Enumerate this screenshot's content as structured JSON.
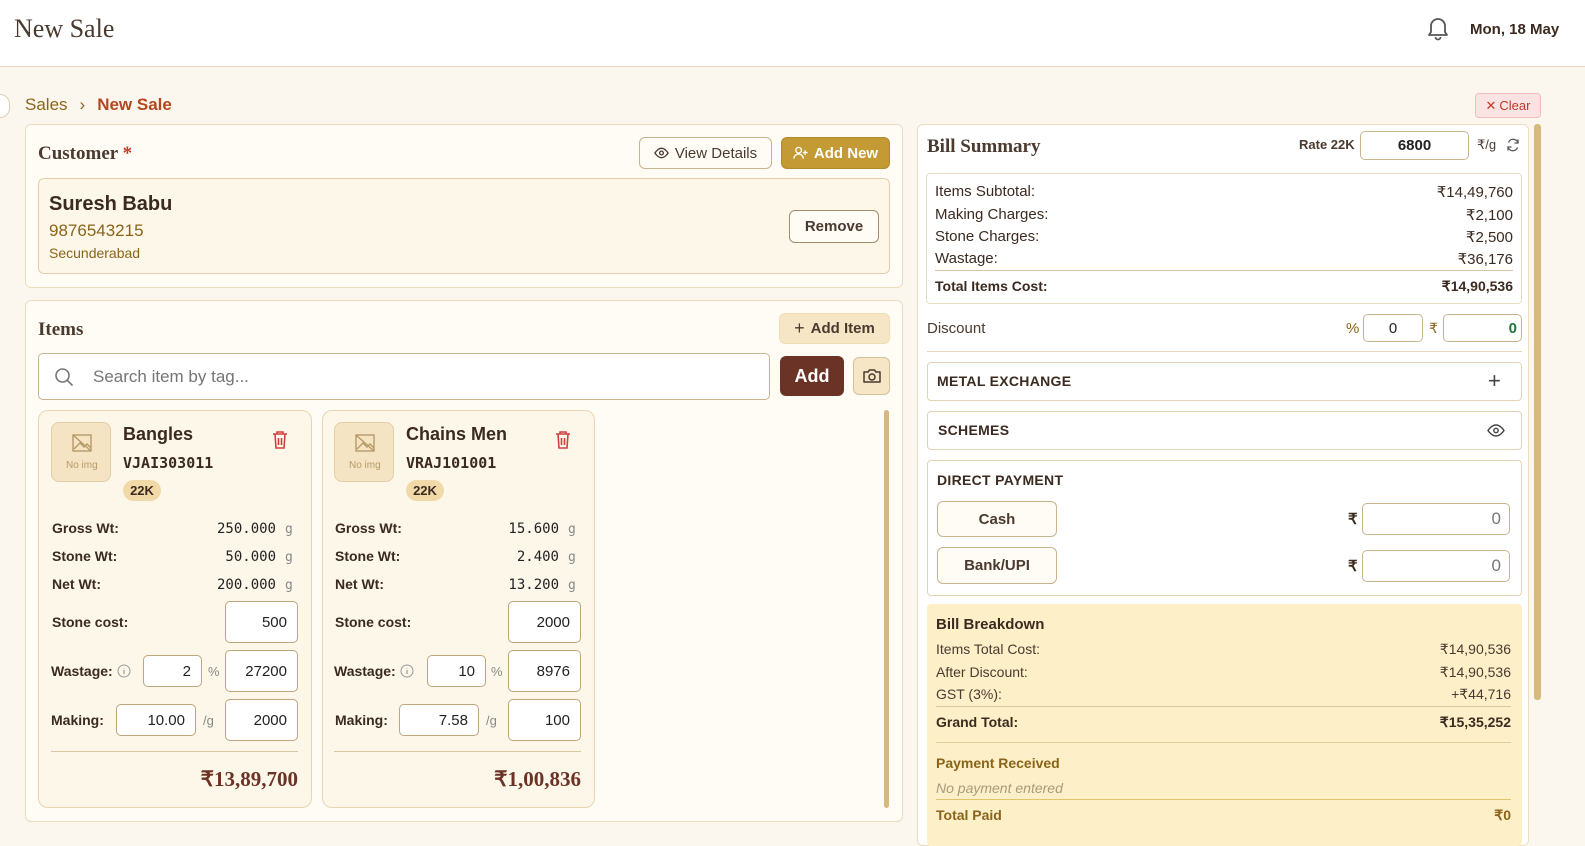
{
  "header": {
    "title": "New Sale",
    "date": "Mon, 18 May"
  },
  "breadcrumb": {
    "parent": "Sales",
    "current": "New Sale"
  },
  "clear_label": "Clear",
  "customer": {
    "heading": "Customer",
    "required_mark": "*",
    "view_details_label": "View Details",
    "add_new_label": "Add New",
    "name": "Suresh Babu",
    "phone": "9876543215",
    "city": "Secunderabad",
    "remove_label": "Remove"
  },
  "items": {
    "heading": "Items",
    "add_item_label": "Add Item",
    "search_placeholder": "Search item by tag...",
    "add_label": "Add",
    "labels": {
      "gross": "Gross Wt:",
      "stone": "Stone Wt:",
      "net": "Net Wt:",
      "stone_cost": "Stone cost:",
      "wastage": "Wastage:",
      "making": "Making:",
      "g": "g",
      "pct": "%",
      "per_g": "/g",
      "no_img": "No img"
    },
    "list": [
      {
        "name": "Bangles",
        "tag": "VJAI303011",
        "purity": "22K",
        "gross": "250.000",
        "stone": "50.000",
        "net": "200.000",
        "stone_cost": "500",
        "wastage_pct": "2",
        "wastage_amt": "27200",
        "making_rate": "10.00",
        "making_amt": "2000",
        "total": "₹13,89,700"
      },
      {
        "name": "Chains Men",
        "tag": "VRAJ101001",
        "purity": "22K",
        "gross": "15.600",
        "stone": "2.400",
        "net": "13.200",
        "stone_cost": "2000",
        "wastage_pct": "10",
        "wastage_amt": "8976",
        "making_rate": "7.58",
        "making_amt": "100",
        "total": "₹1,00,836"
      }
    ]
  },
  "summary": {
    "heading": "Bill Summary",
    "rate_label": "Rate 22K",
    "rate_value": "6800",
    "rate_unit": "₹/g",
    "subtotal_rows": [
      {
        "label": "Items Subtotal:",
        "value": "₹14,49,760"
      },
      {
        "label": "Making Charges:",
        "value": "₹2,100"
      },
      {
        "label": "Stone Charges:",
        "value": "₹2,500"
      },
      {
        "label": "Wastage:",
        "value": "₹36,176"
      }
    ],
    "total_items_label": "Total Items Cost:",
    "total_items_value": "₹14,90,536",
    "discount_label": "Discount",
    "discount_pct_symbol": "%",
    "discount_pct": "0",
    "discount_rs_symbol": "₹",
    "discount_amt": "0",
    "metal_exchange": "METAL EXCHANGE",
    "schemes": "SCHEMES",
    "direct_payment": "DIRECT PAYMENT",
    "cash_label": "Cash",
    "bank_label": "Bank/UPI",
    "rupee": "₹",
    "cash_placeholder": "0",
    "bank_placeholder": "0",
    "breakdown": {
      "heading": "Bill Breakdown",
      "rows": [
        {
          "label": "Items Total Cost:",
          "value": "₹14,90,536"
        },
        {
          "label": "After Discount:",
          "value": "₹14,90,536"
        },
        {
          "label": "GST (3%):",
          "value": "+₹44,716"
        }
      ],
      "grand_label": "Grand Total:",
      "grand_value": "₹15,35,252",
      "payment_heading": "Payment Received",
      "no_payment": "No payment entered",
      "total_paid_label": "Total Paid",
      "total_paid_value": "₹0"
    }
  }
}
